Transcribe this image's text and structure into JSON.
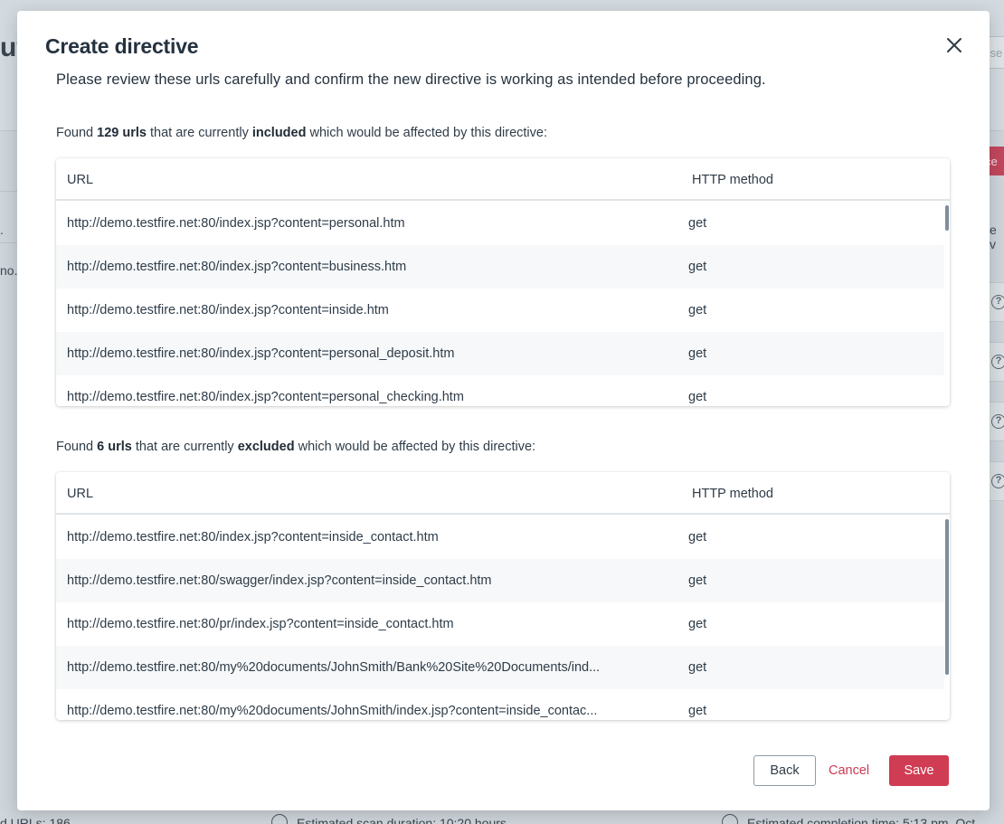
{
  "background": {
    "page_title_fragment": "ut",
    "search_fragment": "sse",
    "side_fragment_1": ".",
    "side_fragment_2": "no.",
    "button_fragment": "ce",
    "right_fragment": "e v",
    "footer": {
      "total_urls": "d URLs: 186",
      "estimated_duration": "Estimated scan duration: 10:20 hours",
      "estimated_completion": "Estimated completion time: 5:13 pm, Oct"
    }
  },
  "modal": {
    "title": "Create directive",
    "intro": "Please review these urls carefully and confirm the new directive is working as intended before proceeding.",
    "included": {
      "prefix": "Found ",
      "count": "129 urls",
      "middle": " that are currently ",
      "state": "included",
      "suffix": " which would be affected by this directive:",
      "columns": {
        "url": "URL",
        "method": "HTTP method"
      },
      "rows": [
        {
          "url": "http://demo.testfire.net:80/index.jsp?content=personal.htm",
          "method": "get"
        },
        {
          "url": "http://demo.testfire.net:80/index.jsp?content=business.htm",
          "method": "get"
        },
        {
          "url": "http://demo.testfire.net:80/index.jsp?content=inside.htm",
          "method": "get"
        },
        {
          "url": "http://demo.testfire.net:80/index.jsp?content=personal_deposit.htm",
          "method": "get"
        },
        {
          "url": "http://demo.testfire.net:80/index.jsp?content=personal_checking.htm",
          "method": "get"
        }
      ]
    },
    "excluded": {
      "prefix": "Found ",
      "count": "6 urls",
      "middle": " that are currently ",
      "state": "excluded",
      "suffix": " which would be affected by this directive:",
      "columns": {
        "url": "URL",
        "method": "HTTP method"
      },
      "rows": [
        {
          "url": "http://demo.testfire.net:80/index.jsp?content=inside_contact.htm",
          "method": "get"
        },
        {
          "url": "http://demo.testfire.net:80/swagger/index.jsp?content=inside_contact.htm",
          "method": "get"
        },
        {
          "url": "http://demo.testfire.net:80/pr/index.jsp?content=inside_contact.htm",
          "method": "get"
        },
        {
          "url": "http://demo.testfire.net:80/my%20documents/JohnSmith/Bank%20Site%20Documents/ind...",
          "method": "get"
        },
        {
          "url": "http://demo.testfire.net:80/my%20documents/JohnSmith/index.jsp?content=inside_contac...",
          "method": "get"
        }
      ]
    },
    "buttons": {
      "back": "Back",
      "cancel": "Cancel",
      "save": "Save"
    }
  },
  "colors": {
    "primary": "#d03c53",
    "text": "#2f3c48",
    "row_alt": "#f6f8f9"
  },
  "icons": {
    "close": "close-icon",
    "help": "help-circle-icon",
    "info": "info-circle-icon"
  }
}
